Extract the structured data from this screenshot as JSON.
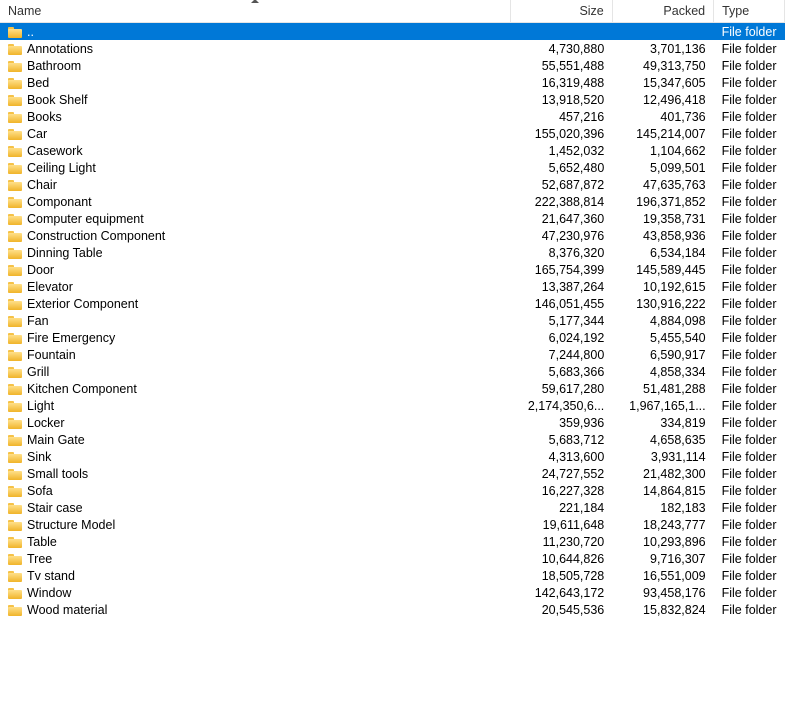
{
  "columns": {
    "name": "Name",
    "size": "Size",
    "packed": "Packed",
    "type": "Type"
  },
  "parent_row": {
    "name": "..",
    "size": "",
    "packed": "",
    "type": "File folder",
    "selected": true
  },
  "rows": [
    {
      "name": "Annotations",
      "size": "4,730,880",
      "packed": "3,701,136",
      "type": "File folder"
    },
    {
      "name": "Bathroom",
      "size": "55,551,488",
      "packed": "49,313,750",
      "type": "File folder"
    },
    {
      "name": "Bed",
      "size": "16,319,488",
      "packed": "15,347,605",
      "type": "File folder"
    },
    {
      "name": "Book Shelf",
      "size": "13,918,520",
      "packed": "12,496,418",
      "type": "File folder"
    },
    {
      "name": "Books",
      "size": "457,216",
      "packed": "401,736",
      "type": "File folder"
    },
    {
      "name": "Car",
      "size": "155,020,396",
      "packed": "145,214,007",
      "type": "File folder"
    },
    {
      "name": "Casework",
      "size": "1,452,032",
      "packed": "1,104,662",
      "type": "File folder"
    },
    {
      "name": "Ceiling Light",
      "size": "5,652,480",
      "packed": "5,099,501",
      "type": "File folder"
    },
    {
      "name": "Chair",
      "size": "52,687,872",
      "packed": "47,635,763",
      "type": "File folder"
    },
    {
      "name": "Componant",
      "size": "222,388,814",
      "packed": "196,371,852",
      "type": "File folder"
    },
    {
      "name": "Computer equipment",
      "size": "21,647,360",
      "packed": "19,358,731",
      "type": "File folder"
    },
    {
      "name": "Construction Component",
      "size": "47,230,976",
      "packed": "43,858,936",
      "type": "File folder"
    },
    {
      "name": "Dinning Table",
      "size": "8,376,320",
      "packed": "6,534,184",
      "type": "File folder"
    },
    {
      "name": "Door",
      "size": "165,754,399",
      "packed": "145,589,445",
      "type": "File folder"
    },
    {
      "name": "Elevator",
      "size": "13,387,264",
      "packed": "10,192,615",
      "type": "File folder"
    },
    {
      "name": "Exterior Component",
      "size": "146,051,455",
      "packed": "130,916,222",
      "type": "File folder"
    },
    {
      "name": "Fan",
      "size": "5,177,344",
      "packed": "4,884,098",
      "type": "File folder"
    },
    {
      "name": "Fire Emergency",
      "size": "6,024,192",
      "packed": "5,455,540",
      "type": "File folder"
    },
    {
      "name": "Fountain",
      "size": "7,244,800",
      "packed": "6,590,917",
      "type": "File folder"
    },
    {
      "name": "Grill",
      "size": "5,683,366",
      "packed": "4,858,334",
      "type": "File folder"
    },
    {
      "name": "Kitchen Component",
      "size": "59,617,280",
      "packed": "51,481,288",
      "type": "File folder"
    },
    {
      "name": "Light",
      "size": "2,174,350,6...",
      "packed": "1,967,165,1...",
      "type": "File folder"
    },
    {
      "name": "Locker",
      "size": "359,936",
      "packed": "334,819",
      "type": "File folder"
    },
    {
      "name": "Main Gate",
      "size": "5,683,712",
      "packed": "4,658,635",
      "type": "File folder"
    },
    {
      "name": "Sink",
      "size": "4,313,600",
      "packed": "3,931,114",
      "type": "File folder"
    },
    {
      "name": "Small tools",
      "size": "24,727,552",
      "packed": "21,482,300",
      "type": "File folder"
    },
    {
      "name": "Sofa",
      "size": "16,227,328",
      "packed": "14,864,815",
      "type": "File folder"
    },
    {
      "name": "Stair case",
      "size": "221,184",
      "packed": "182,183",
      "type": "File folder"
    },
    {
      "name": "Structure Model",
      "size": "19,611,648",
      "packed": "18,243,777",
      "type": "File folder"
    },
    {
      "name": "Table",
      "size": "11,230,720",
      "packed": "10,293,896",
      "type": "File folder"
    },
    {
      "name": "Tree",
      "size": "10,644,826",
      "packed": "9,716,307",
      "type": "File folder"
    },
    {
      "name": "Tv stand",
      "size": "18,505,728",
      "packed": "16,551,009",
      "type": "File folder"
    },
    {
      "name": "Window",
      "size": "142,643,172",
      "packed": "93,458,176",
      "type": "File folder"
    },
    {
      "name": "Wood material",
      "size": "20,545,536",
      "packed": "15,832,824",
      "type": "File folder"
    }
  ]
}
